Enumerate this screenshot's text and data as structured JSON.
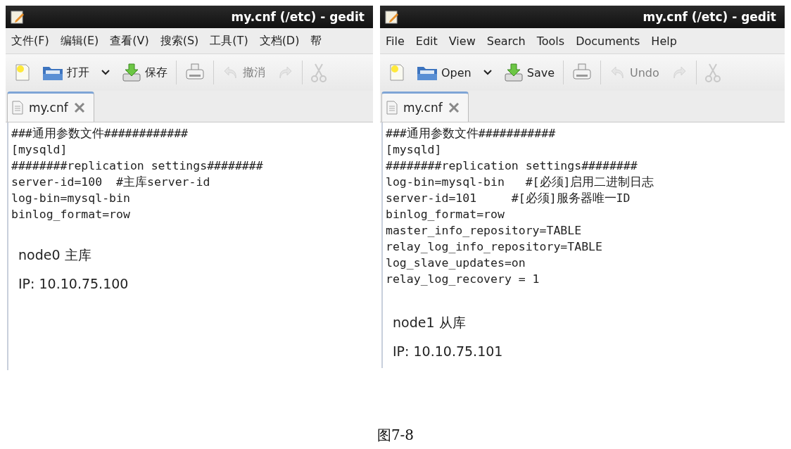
{
  "windows": [
    {
      "title": "my.cnf (/etc) - gedit",
      "menu": [
        "文件(F)",
        "编辑(E)",
        "查看(V)",
        "搜索(S)",
        "工具(T)",
        "文档(D)",
        "帮"
      ],
      "toolbar": [
        {
          "kind": "new",
          "disabled": false
        },
        {
          "kind": "open",
          "label": "打开",
          "disabled": false
        },
        {
          "kind": "dropdown",
          "disabled": false
        },
        {
          "kind": "save",
          "label": "保存",
          "disabled": false
        },
        {
          "kind": "separator"
        },
        {
          "kind": "print",
          "disabled": false
        },
        {
          "kind": "separator"
        },
        {
          "kind": "undo",
          "label": "撤消",
          "disabled": true
        },
        {
          "kind": "redo",
          "disabled": true
        },
        {
          "kind": "separator"
        },
        {
          "kind": "cut",
          "disabled": true
        }
      ],
      "tab": {
        "label": "my.cnf",
        "selected": true
      },
      "lines": [
        "###通用参数文件############",
        "[mysqld]",
        "########replication settings########",
        "server-id=100  #主库server-id",
        "log-bin=mysql-bin",
        "binlog_format=row"
      ],
      "notes": [
        "node0 主库",
        "IP: 10.10.75.100"
      ]
    },
    {
      "title": "my.cnf (/etc) - gedit",
      "menu": [
        "File",
        "Edit",
        "View",
        "Search",
        "Tools",
        "Documents",
        "Help"
      ],
      "toolbar": [
        {
          "kind": "new",
          "disabled": false
        },
        {
          "kind": "open",
          "label": "Open",
          "disabled": false
        },
        {
          "kind": "dropdown",
          "disabled": false
        },
        {
          "kind": "save",
          "label": "Save",
          "disabled": false
        },
        {
          "kind": "separator"
        },
        {
          "kind": "print",
          "disabled": false
        },
        {
          "kind": "separator"
        },
        {
          "kind": "undo",
          "label": "Undo",
          "disabled": true
        },
        {
          "kind": "redo",
          "disabled": true
        },
        {
          "kind": "separator"
        },
        {
          "kind": "cut",
          "disabled": true
        }
      ],
      "tab": {
        "label": "my.cnf",
        "selected": true
      },
      "lines": [
        "###通用参数文件###########",
        "[mysqld]",
        "########replication settings########",
        "log-bin=mysql-bin   #[必须]启用二进制日志",
        "server-id=101     #[必须]服务器唯一ID",
        "binlog_format=row",
        "master_info_repository=TABLE",
        "relay_log_info_repository=TABLE",
        "log_slave_updates=on",
        "relay_log_recovery = 1"
      ],
      "notes": [
        "node1 从库",
        "IP: 10.10.75.101"
      ]
    }
  ],
  "caption": "图7-8"
}
